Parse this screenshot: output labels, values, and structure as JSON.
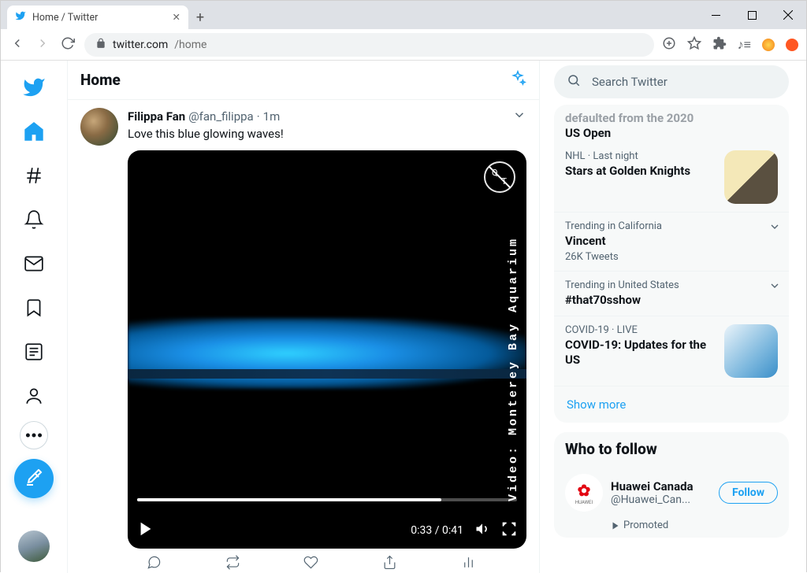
{
  "browser": {
    "tab_title": "Home / Twitter",
    "url_host": "twitter.com",
    "url_path": "/home"
  },
  "header": {
    "title": "Home"
  },
  "tweet": {
    "author": "Filippa Fan",
    "handle": "@fan_filippa",
    "time": "1m",
    "text": "Love this blue glowing waves!",
    "video": {
      "watermark": "Video: Monterey Bay Aquarium",
      "badge_a": "Q",
      "badge_b": "T",
      "current": "0:33",
      "duration": "0:41",
      "time_display": "0:33 / 0:41"
    }
  },
  "search": {
    "placeholder": "Search Twitter"
  },
  "trunc": {
    "line1": "defaulted from the 2020",
    "line2": "US Open"
  },
  "trends": [
    {
      "meta": "NHL · Last night",
      "title": "Stars at Golden Knights",
      "thumb": "hockey"
    },
    {
      "meta": "Trending in California",
      "title": "Vincent",
      "sub": "26K Tweets"
    },
    {
      "meta": "Trending in United States",
      "title": "#that70sshow"
    },
    {
      "meta": "COVID-19 · LIVE",
      "title": "COVID-19: Updates for the US",
      "thumb": "mask"
    }
  ],
  "show_more": "Show more",
  "who_to_follow": {
    "header": "Who to follow",
    "item": {
      "name": "Huawei Canada",
      "handle": "@Huawei_Can...",
      "brand": "HUAWEI",
      "follow": "Follow",
      "promoted": "Promoted"
    }
  }
}
